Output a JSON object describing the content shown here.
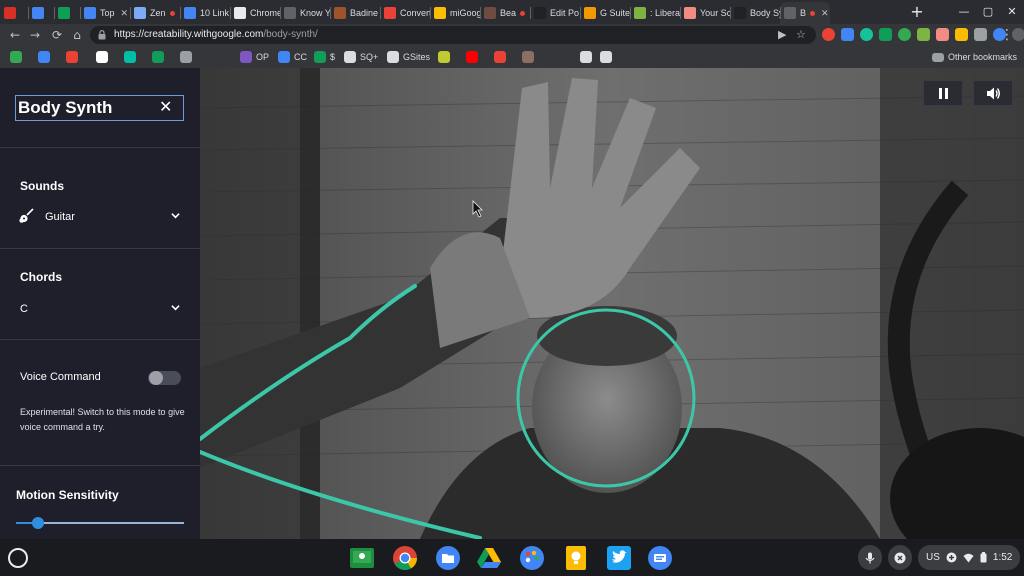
{
  "browser": {
    "tabs": [
      {
        "label": "",
        "color": "#d93025",
        "active": false
      },
      {
        "label": "",
        "color": "#4285f4",
        "active": false
      },
      {
        "label": "",
        "color": "#0f9d58",
        "active": false
      },
      {
        "label": "Top",
        "color": "#4285f4",
        "active": false
      },
      {
        "label": "Zen",
        "color": "#7baaf7",
        "active": false
      },
      {
        "label": "10 Link",
        "color": "#4285f4",
        "active": false
      },
      {
        "label": "Chrome",
        "color": "#e8eaed",
        "active": false
      },
      {
        "label": "Know Y",
        "color": "#5f6368",
        "active": false
      },
      {
        "label": "Badine",
        "color": "#a0522d",
        "active": false
      },
      {
        "label": "Convert",
        "color": "#ea4335",
        "active": false
      },
      {
        "label": "miGoog",
        "color": "#fbbc04",
        "active": false
      },
      {
        "label": "Bea",
        "color": "#6d4c41",
        "active": false
      },
      {
        "label": "Edit Po",
        "color": "#202124",
        "active": false
      },
      {
        "label": "G Suite",
        "color": "#f29900",
        "active": false
      },
      {
        "label": ": Liberat",
        "color": "#7cb342",
        "active": false
      },
      {
        "label": "Your Sc",
        "color": "#f28b82",
        "active": false
      },
      {
        "label": "Body Sy",
        "color": "#202124",
        "active": false
      },
      {
        "label": "B",
        "color": "#5f6368",
        "active": true
      }
    ],
    "new_tab": "+",
    "window_controls": {
      "minimize": "—",
      "maximize": "▢",
      "close": "✕"
    },
    "url_host": "https://creatability.withgoogle.com",
    "url_path": "/body-synth/",
    "menu": "⋮",
    "other_bookmarks": "Other bookmarks",
    "bookmarks": [
      {
        "label": "",
        "color": "#34a853"
      },
      {
        "label": "",
        "color": "#4285f4"
      },
      {
        "label": "",
        "color": "#ea4335"
      },
      {
        "label": "",
        "color": "#ffffff"
      },
      {
        "label": "",
        "color": "#00bfa5"
      },
      {
        "label": "",
        "color": "#0f9d58"
      },
      {
        "label": "",
        "color": "#9aa0a6"
      },
      {
        "label": "OP",
        "color": "#7e57c2"
      },
      {
        "label": "CC",
        "color": "#4285f4"
      },
      {
        "label": "$",
        "color": "#0f9d58"
      },
      {
        "label": "SQ+",
        "color": "#dadce0"
      },
      {
        "label": "GSites",
        "color": "#dadce0"
      },
      {
        "label": "",
        "color": "#c0ca33"
      },
      {
        "label": "",
        "color": "#ff0000"
      },
      {
        "label": "",
        "color": "#ea4335"
      },
      {
        "label": "",
        "color": "#8d6e63"
      },
      {
        "label": "",
        "color": "#dadce0"
      },
      {
        "label": "",
        "color": "#dadce0"
      }
    ]
  },
  "sidebar": {
    "title": "Body Synth",
    "close_glyph": "✕",
    "sounds": {
      "label": "Sounds",
      "value": "Guitar"
    },
    "chords": {
      "label": "Chords",
      "value": "C"
    },
    "voice": {
      "label": "Voice Command",
      "enabled": false,
      "help": "Experimental! Switch to this mode to give voice command a try."
    },
    "motion": {
      "label": "Motion Sensitivity",
      "value": 0.13
    }
  },
  "main": {
    "pause_icon": "pause-icon",
    "volume_icon": "volume-icon",
    "accent": "#3cc8a8"
  },
  "shelf": {
    "apps": [
      "google-classroom",
      "chrome",
      "files",
      "drive",
      "canvas",
      "keep",
      "twitter",
      "docs"
    ],
    "locale": "US",
    "time": "1:52"
  }
}
